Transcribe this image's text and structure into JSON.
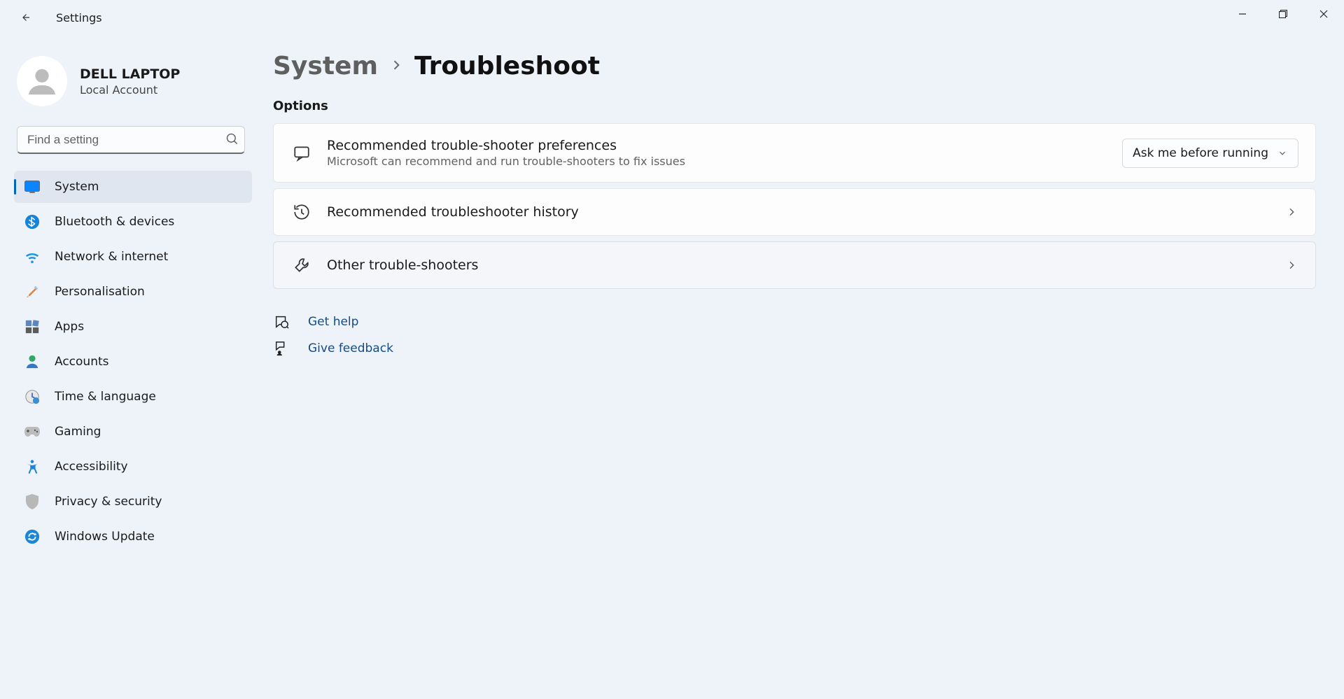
{
  "window": {
    "title": "Settings"
  },
  "user": {
    "name": "DELL LAPTOP",
    "subtitle": "Local Account"
  },
  "search": {
    "placeholder": "Find a setting"
  },
  "nav": {
    "items": [
      {
        "label": "System"
      },
      {
        "label": "Bluetooth & devices"
      },
      {
        "label": "Network & internet"
      },
      {
        "label": "Personalisation"
      },
      {
        "label": "Apps"
      },
      {
        "label": "Accounts"
      },
      {
        "label": "Time & language"
      },
      {
        "label": "Gaming"
      },
      {
        "label": "Accessibility"
      },
      {
        "label": "Privacy & security"
      },
      {
        "label": "Windows Update"
      }
    ]
  },
  "breadcrumb": {
    "parent": "System",
    "current": "Troubleshoot"
  },
  "section": {
    "heading": "Options"
  },
  "cards": {
    "pref": {
      "title": "Recommended trouble-shooter preferences",
      "sub": "Microsoft can recommend and run trouble-shooters to fix issues",
      "dropdown": "Ask me before running"
    },
    "history": {
      "title": "Recommended troubleshooter history"
    },
    "other": {
      "title": "Other trouble-shooters"
    }
  },
  "help": {
    "get_help": "Get help",
    "feedback": "Give feedback"
  }
}
